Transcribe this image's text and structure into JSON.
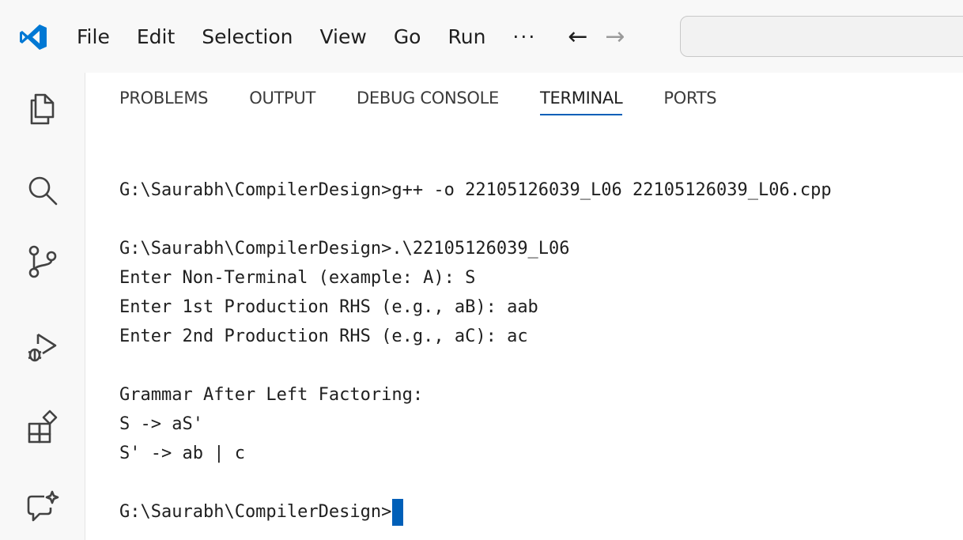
{
  "titlebar": {
    "logo_icon": "vscode-logo-icon",
    "menu": [
      "File",
      "Edit",
      "Selection",
      "View",
      "Go",
      "Run",
      "···"
    ],
    "nav_back_icon": "arrow-left-icon",
    "nav_forward_icon": "arrow-right-icon",
    "command_center_value": ""
  },
  "activitybar": {
    "items": [
      {
        "name": "explorer",
        "icon": "files-icon"
      },
      {
        "name": "search",
        "icon": "search-icon"
      },
      {
        "name": "source-control",
        "icon": "source-control-icon"
      },
      {
        "name": "run-debug",
        "icon": "run-debug-icon"
      },
      {
        "name": "extensions",
        "icon": "extensions-icon"
      },
      {
        "name": "chat",
        "icon": "chat-sparkle-icon"
      }
    ]
  },
  "panel": {
    "tabs": [
      {
        "label": "PROBLEMS",
        "active": false
      },
      {
        "label": "OUTPUT",
        "active": false
      },
      {
        "label": "DEBUG CONSOLE",
        "active": false
      },
      {
        "label": "TERMINAL",
        "active": true
      },
      {
        "label": "PORTS",
        "active": false
      }
    ],
    "terminal_lines": [
      "G:\\Saurabh\\CompilerDesign>g++ -o 22105126039_L06 22105126039_L06.cpp",
      "",
      "G:\\Saurabh\\CompilerDesign>.\\22105126039_L06",
      "Enter Non-Terminal (example: A): S",
      "Enter 1st Production RHS (e.g., aB): aab",
      "Enter 2nd Production RHS (e.g., aC): ac",
      "",
      "Grammar After Left Factoring:",
      "S -> aS'",
      "S' -> ab | c",
      "",
      "G:\\Saurabh\\CompilerDesign>"
    ]
  },
  "colors": {
    "accent": "#005fb8",
    "logo": "#0078d4",
    "background": "#ffffff",
    "chrome": "#f8f8f8"
  }
}
